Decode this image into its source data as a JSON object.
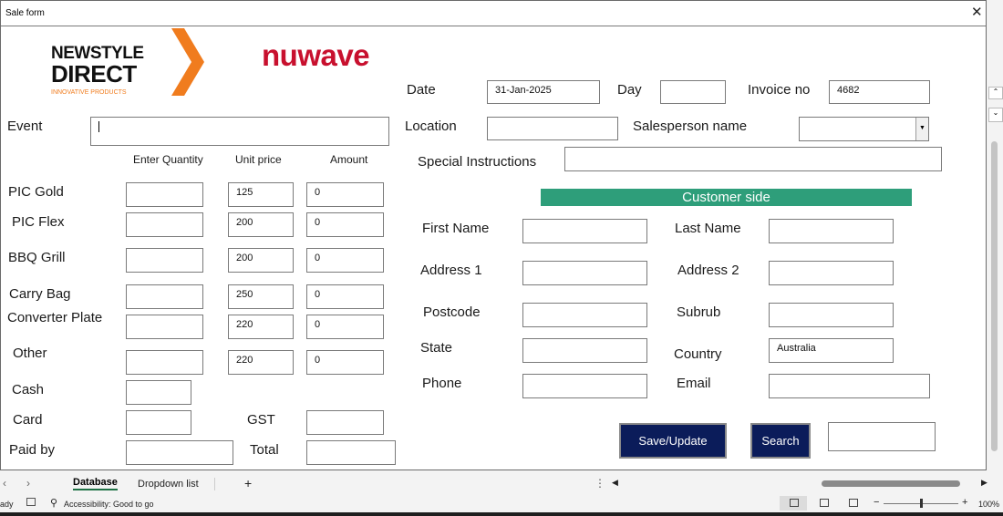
{
  "window": {
    "title": "Sale form",
    "close_glyph": "✕"
  },
  "logos": {
    "newstyle_line1": "NEWSTYLE",
    "newstyle_line2": "DIRECT",
    "newstyle_tagline": "INNOVATIVE PRODUCTS",
    "nuwave": "nuwave"
  },
  "header": {
    "date_label": "Date",
    "date_value": "31-Jan-2025",
    "day_label": "Day",
    "day_value": "",
    "invoice_label": "Invoice no",
    "invoice_value": "4682",
    "location_label": "Location",
    "location_value": "",
    "salesperson_label": "Salesperson name",
    "salesperson_value": "",
    "special_label": "Special Instructions",
    "special_value": ""
  },
  "event": {
    "label": "Event",
    "value": ""
  },
  "columns": {
    "qty": "Enter Quantity",
    "price": "Unit price",
    "amount": "Amount"
  },
  "products": [
    {
      "name": "PIC Gold",
      "qty": "",
      "price": "125",
      "amount": "0"
    },
    {
      "name": "PIC Flex",
      "qty": "",
      "price": "200",
      "amount": "0"
    },
    {
      "name": "BBQ Grill",
      "qty": "",
      "price": "200",
      "amount": "0"
    },
    {
      "name": "Carry Bag",
      "qty": "",
      "price": "250",
      "amount": "0"
    },
    {
      "name": "Converter Plate",
      "qty": "",
      "price": "220",
      "amount": "0"
    },
    {
      "name": "Other",
      "qty": "",
      "price": "220",
      "amount": "0"
    }
  ],
  "payment": {
    "cash_label": "Cash",
    "cash_value": "",
    "card_label": "Card",
    "card_value": "",
    "paidby_label": "Paid by",
    "paidby_value": "",
    "gst_label": "GST",
    "gst_value": "",
    "total_label": "Total",
    "total_value": ""
  },
  "customer": {
    "section_title": "Customer side",
    "first_name_label": "First Name",
    "first_name": "",
    "last_name_label": "Last Name",
    "last_name": "",
    "address1_label": "Address 1",
    "address1": "",
    "address2_label": "Address 2",
    "address2": "",
    "postcode_label": "Postcode",
    "postcode": "",
    "suburb_label": "Subrub",
    "suburb": "",
    "state_label": "State",
    "state": "",
    "country_label": "Country",
    "country": "Australia",
    "phone_label": "Phone",
    "phone": "",
    "email_label": "Email",
    "email": ""
  },
  "actions": {
    "save": "Save/Update",
    "search": "Search",
    "search_value": ""
  },
  "sheets": {
    "tab1": "Database",
    "tab2": "Dropdown list",
    "add": "+"
  },
  "statusbar": {
    "ready": "ady",
    "accessibility": "Accessibility: Good to go",
    "zoom_minus": "−",
    "zoom_plus": "+",
    "zoom": "100%"
  },
  "colors": {
    "brand_orange": "#f07c1e",
    "nuwave_red": "#c8102e",
    "section_green": "#2e9e7a",
    "button_navy": "#0b1c5a"
  }
}
